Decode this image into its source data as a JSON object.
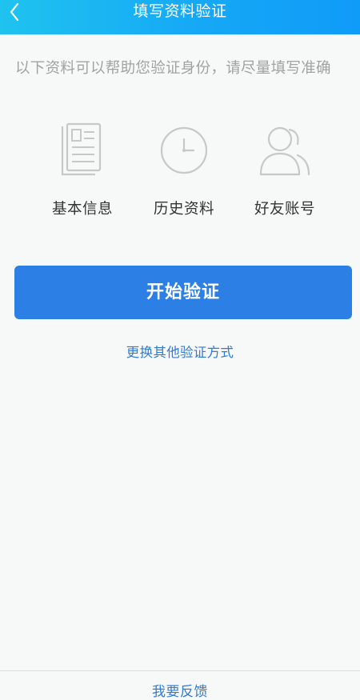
{
  "header": {
    "title": "填写资料验证"
  },
  "hint": "以下资料可以帮助您验证身份，请尽量填写准确",
  "items": [
    {
      "label": "基本信息",
      "icon": "document-icon"
    },
    {
      "label": "历史资料",
      "icon": "clock-icon"
    },
    {
      "label": "好友账号",
      "icon": "friends-icon"
    }
  ],
  "actions": {
    "start_label": "开始验证",
    "alternate_label": "更换其他验证方式"
  },
  "footer": {
    "feedback_label": "我要反馈"
  },
  "colors": {
    "header_start": "#1fc3ef",
    "header_end": "#0f9bf8",
    "primary_button": "#2b7fe5",
    "link": "#2f7bd6",
    "icon_gray": "#c8c8c8"
  }
}
